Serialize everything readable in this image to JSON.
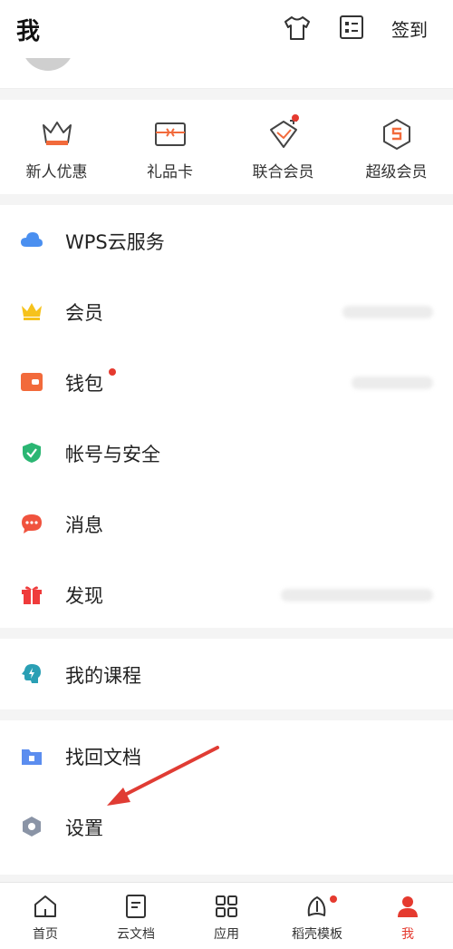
{
  "header": {
    "title": "我",
    "signin_label": "签到"
  },
  "quick_actions": [
    {
      "label": "新人优惠",
      "icon": "crown-outline-icon"
    },
    {
      "label": "礼品卡",
      "icon": "gift-card-icon"
    },
    {
      "label": "联合会员",
      "icon": "joint-member-icon"
    },
    {
      "label": "超级会员",
      "icon": "super-member-icon"
    }
  ],
  "menu": {
    "cloud": {
      "label": "WPS云服务",
      "icon": "cloud-icon"
    },
    "member": {
      "label": "会员",
      "icon": "crown-icon"
    },
    "wallet": {
      "label": "钱包",
      "icon": "wallet-icon"
    },
    "account": {
      "label": "帐号与安全",
      "icon": "shield-icon"
    },
    "messages": {
      "label": "消息",
      "icon": "chat-icon"
    },
    "discover": {
      "label": "发现",
      "icon": "gift-icon"
    },
    "courses": {
      "label": "我的课程",
      "icon": "courses-icon"
    },
    "recover": {
      "label": "找回文档",
      "icon": "folder-recover-icon"
    },
    "settings": {
      "label": "设置",
      "icon": "hexagon-settings-icon"
    }
  },
  "tabs": [
    {
      "label": "首页",
      "icon": "home-icon"
    },
    {
      "label": "云文档",
      "icon": "cloud-doc-icon"
    },
    {
      "label": "应用",
      "icon": "apps-grid-icon"
    },
    {
      "label": "稻壳模板",
      "icon": "leaf-icon"
    },
    {
      "label": "我",
      "icon": "person-icon"
    }
  ],
  "colors": {
    "accent": "#e53a2f",
    "cloud": "#4a8ff0",
    "crown": "#f6c21c",
    "wallet": "#f26a3b",
    "shield": "#2bb673",
    "chat": "#f0533e",
    "gift": "#ef3b3b",
    "course": "#2a9fb4",
    "folder": "#5b8def",
    "hexagon": "#8a94a6"
  }
}
